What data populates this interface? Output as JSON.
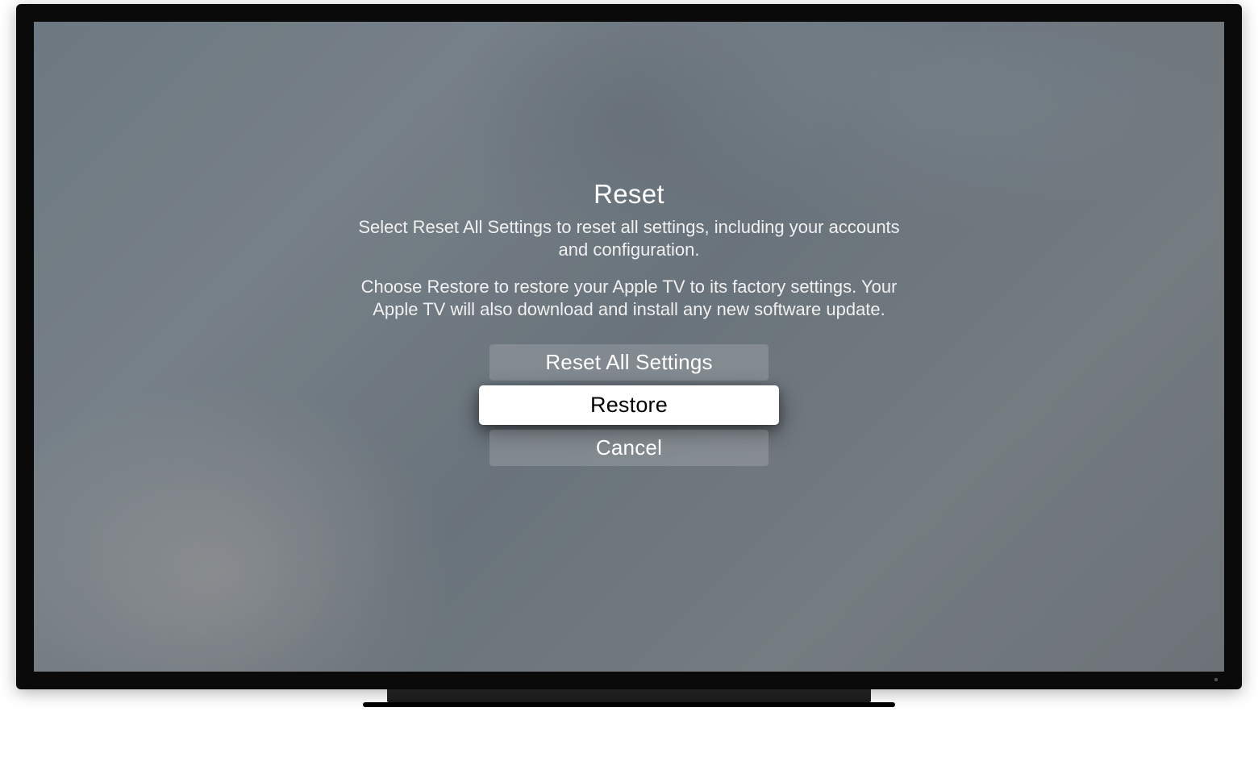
{
  "dialog": {
    "title": "Reset",
    "paragraph1": "Select Reset All Settings to reset all settings, including your accounts and configuration.",
    "paragraph2": "Choose Restore to restore your Apple TV to its factory settings. Your Apple TV will also download and install any new software update.",
    "buttons": {
      "reset_all": "Reset All Settings",
      "restore": "Restore",
      "cancel": "Cancel"
    }
  }
}
